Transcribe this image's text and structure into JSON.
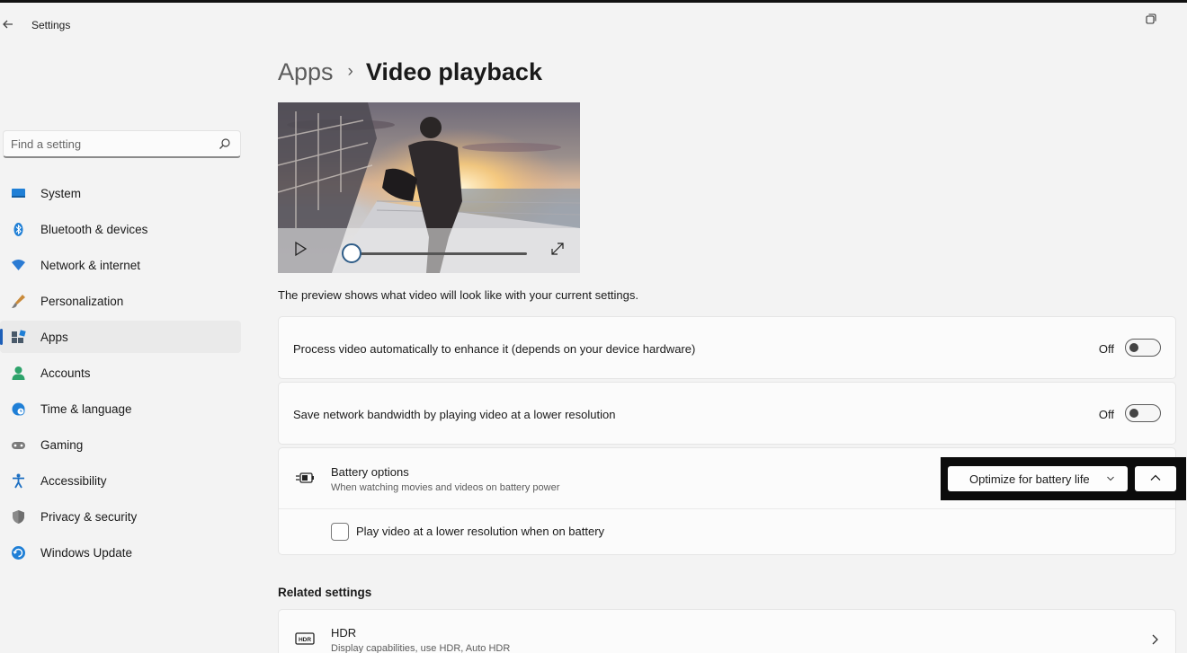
{
  "window": {
    "title": "Settings"
  },
  "search": {
    "placeholder": "Find a setting"
  },
  "sidebar": {
    "items": [
      {
        "label": "System",
        "icon": "monitor-icon",
        "color": "#1f7fd6"
      },
      {
        "label": "Bluetooth & devices",
        "icon": "bluetooth-icon",
        "color": "#1f7fd6"
      },
      {
        "label": "Network & internet",
        "icon": "wifi-icon",
        "color": "#2b7bd3"
      },
      {
        "label": "Personalization",
        "icon": "paintbrush-icon",
        "color": "#c98a3a"
      },
      {
        "label": "Apps",
        "icon": "apps-icon",
        "color": "#4a5a6a",
        "active": true
      },
      {
        "label": "Accounts",
        "icon": "person-icon",
        "color": "#2ea36b"
      },
      {
        "label": "Time & language",
        "icon": "globe-clock-icon",
        "color": "#1f7fd6"
      },
      {
        "label": "Gaming",
        "icon": "gamepad-icon",
        "color": "#7a7a7a"
      },
      {
        "label": "Accessibility",
        "icon": "accessibility-icon",
        "color": "#1d6fc2"
      },
      {
        "label": "Privacy & security",
        "icon": "shield-icon",
        "color": "#8a8a8a"
      },
      {
        "label": "Windows Update",
        "icon": "update-icon",
        "color": "#1f7fd6"
      }
    ]
  },
  "breadcrumb": {
    "parent": "Apps",
    "separator": "›",
    "current": "Video playback"
  },
  "preview": {
    "caption": "The preview shows what video will look like with your current settings.",
    "seek_position": 0.05
  },
  "settings": {
    "process_video": {
      "label": "Process video automatically to enhance it (depends on your device hardware)",
      "state": "Off"
    },
    "save_bandwidth": {
      "label": "Save network bandwidth by playing video at a lower resolution",
      "state": "Off"
    },
    "battery": {
      "title": "Battery options",
      "subtitle": "When watching movies and videos on battery power",
      "selected": "Optimize for battery life",
      "checkbox_label": "Play video at a lower resolution when on battery"
    }
  },
  "related": {
    "heading": "Related settings",
    "hdr_title": "HDR",
    "hdr_subtitle": "Display capabilities, use HDR, Auto HDR"
  },
  "colors": {
    "accent": "#1d5fb8",
    "highlight_border": "#0b0b0b"
  }
}
